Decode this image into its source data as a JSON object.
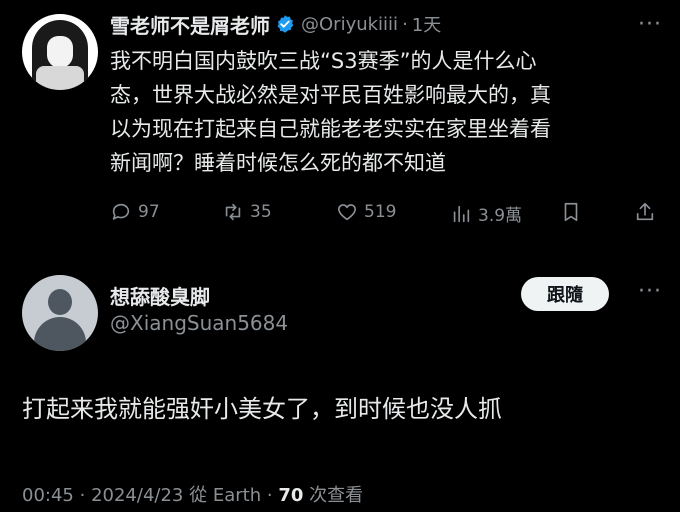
{
  "original_tweet": {
    "display_name": "雪老师不是屑老师",
    "handle": "@Oriyukiiii",
    "separator": "·",
    "time": "1天",
    "text": "我不明白国内鼓吹三战“S3赛季”的人是什么心\n态，世界大战必然是对平民百姓影响最大的，真\n以为现在打起来自己就能老老实实在家里坐着看\n新闻啊？睡着时候怎么死的都不知道",
    "metrics": {
      "replies": "97",
      "retweets": "35",
      "likes": "519",
      "views": "3.9萬"
    },
    "icons": [
      "verified-badge-icon",
      "more-icon",
      "reply-icon",
      "retweet-icon",
      "like-icon",
      "views-icon",
      "bookmark-icon",
      "share-icon"
    ],
    "more_label": "···"
  },
  "reply_tweet": {
    "display_name": "想舔酸臭脚",
    "handle": "@XiangSuan5684",
    "follow_label": "跟隨",
    "more_label": "···",
    "text": "打起来我就能强奸小美女了，到时候也没人抓",
    "meta": {
      "time": "00:45",
      "sep1": "·",
      "date": "2024/4/23",
      "source": "從 Earth",
      "sep2": "·",
      "views_count": "70",
      "views_label": "次查看"
    }
  },
  "colors": {
    "background": "#000000",
    "text_primary": "#e7e9ea",
    "text_secondary": "#8b9095",
    "verified_blue": "#1d9bf0",
    "follow_button_bg": "#eff3f4"
  }
}
